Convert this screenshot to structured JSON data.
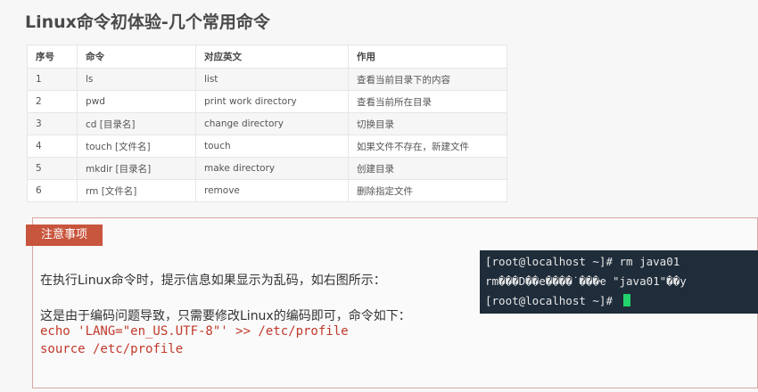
{
  "title": "Linux命令初体验-几个常用命令",
  "table": {
    "headers": [
      "序号",
      "命令",
      "对应英文",
      "作用"
    ],
    "rows": [
      [
        "1",
        "ls",
        "list",
        "查看当前目录下的内容"
      ],
      [
        "2",
        "pwd",
        "print work directory",
        "查看当前所在目录"
      ],
      [
        "3",
        "cd [目录名]",
        "change directory",
        "切换目录"
      ],
      [
        "4",
        "touch [文件名]",
        "touch",
        "如果文件不存在，新建文件"
      ],
      [
        "5",
        "mkdir [目录名]",
        "make directory",
        "创建目录"
      ],
      [
        "6",
        "rm [文件名]",
        "remove",
        "删除指定文件"
      ]
    ]
  },
  "note": {
    "tag": "注意事项",
    "line1": "在执行Linux命令时，提示信息如果显示为乱码，如右图所示：",
    "line2": "这是由于编码问题导致，只需要修改Linux的编码即可，命令如下：",
    "code1": "echo 'LANG=\"en_US.UTF-8\"' >> /etc/profile",
    "code2": "source /etc/profile"
  },
  "terminal": {
    "line1": "[root@localhost ~]# rm java01",
    "line2": "rm���D��e����˙���ҽ \"java01\"��y",
    "line3": "[root@localhost ~]# "
  },
  "colors": {
    "tag_bg": "#c8553d",
    "code_text": "#c0392b",
    "terminal_bg": "#1f2c3a",
    "cursor": "#22d36b"
  }
}
